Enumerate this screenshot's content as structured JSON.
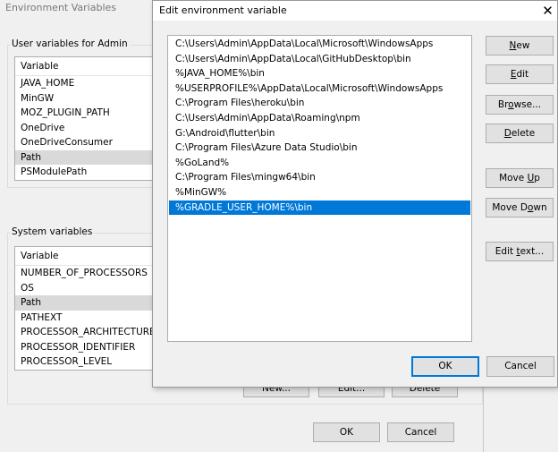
{
  "bg": {
    "title": "Environment Variables",
    "user_group_label": "User variables for Admin",
    "user_list": {
      "header": "Variable",
      "rows": [
        "JAVA_HOME",
        "MinGW",
        "MOZ_PLUGIN_PATH",
        "OneDrive",
        "OneDriveConsumer",
        "Path",
        "PSModulePath"
      ],
      "selected_index": 5
    },
    "system_group_label": "System variables",
    "system_list": {
      "header": "Variable",
      "rows": [
        "NUMBER_OF_PROCESSORS",
        "OS",
        "Path",
        "PATHEXT",
        "PROCESSOR_ARCHITECTURE",
        "PROCESSOR_IDENTIFIER",
        "PROCESSOR_LEVEL"
      ],
      "selected_index": 2
    },
    "system_buttons": {
      "new": "New...",
      "edit": "Edit...",
      "delete": "Delete"
    },
    "ok": "OK",
    "cancel": "Cancel"
  },
  "dialog": {
    "title": "Edit environment variable",
    "close_icon": "close-icon",
    "entries": [
      "C:\\Users\\Admin\\AppData\\Local\\Microsoft\\WindowsApps",
      "C:\\Users\\Admin\\AppData\\Local\\GitHubDesktop\\bin",
      "%JAVA_HOME%\\bin",
      "%USERPROFILE%\\AppData\\Local\\Microsoft\\WindowsApps",
      "C:\\Program Files\\heroku\\bin",
      "C:\\Users\\Admin\\AppData\\Roaming\\npm",
      "G:\\Android\\flutter\\bin",
      "C:\\Program Files\\Azure Data Studio\\bin",
      "%GoLand%",
      "C:\\Program Files\\mingw64\\bin",
      "%MinGW%",
      "%GRADLE_USER_HOME%\\bin"
    ],
    "selected_index": 11,
    "buttons": {
      "new": {
        "m": "N",
        "rest": "ew"
      },
      "edit": {
        "m": "E",
        "rest": "dit"
      },
      "browse": {
        "pre": "Br",
        "m": "o",
        "rest": "wse..."
      },
      "delete": {
        "m": "D",
        "rest": "elete"
      },
      "move_up": {
        "pre": "Move ",
        "m": "U",
        "rest": "p"
      },
      "move_down": {
        "pre": "Move D",
        "m": "o",
        "rest": "wn"
      },
      "edit_text": {
        "pre": "Edit ",
        "m": "t",
        "rest": "ext..."
      }
    },
    "ok": "OK",
    "cancel": "Cancel",
    "selection_color": "#0078d7"
  }
}
